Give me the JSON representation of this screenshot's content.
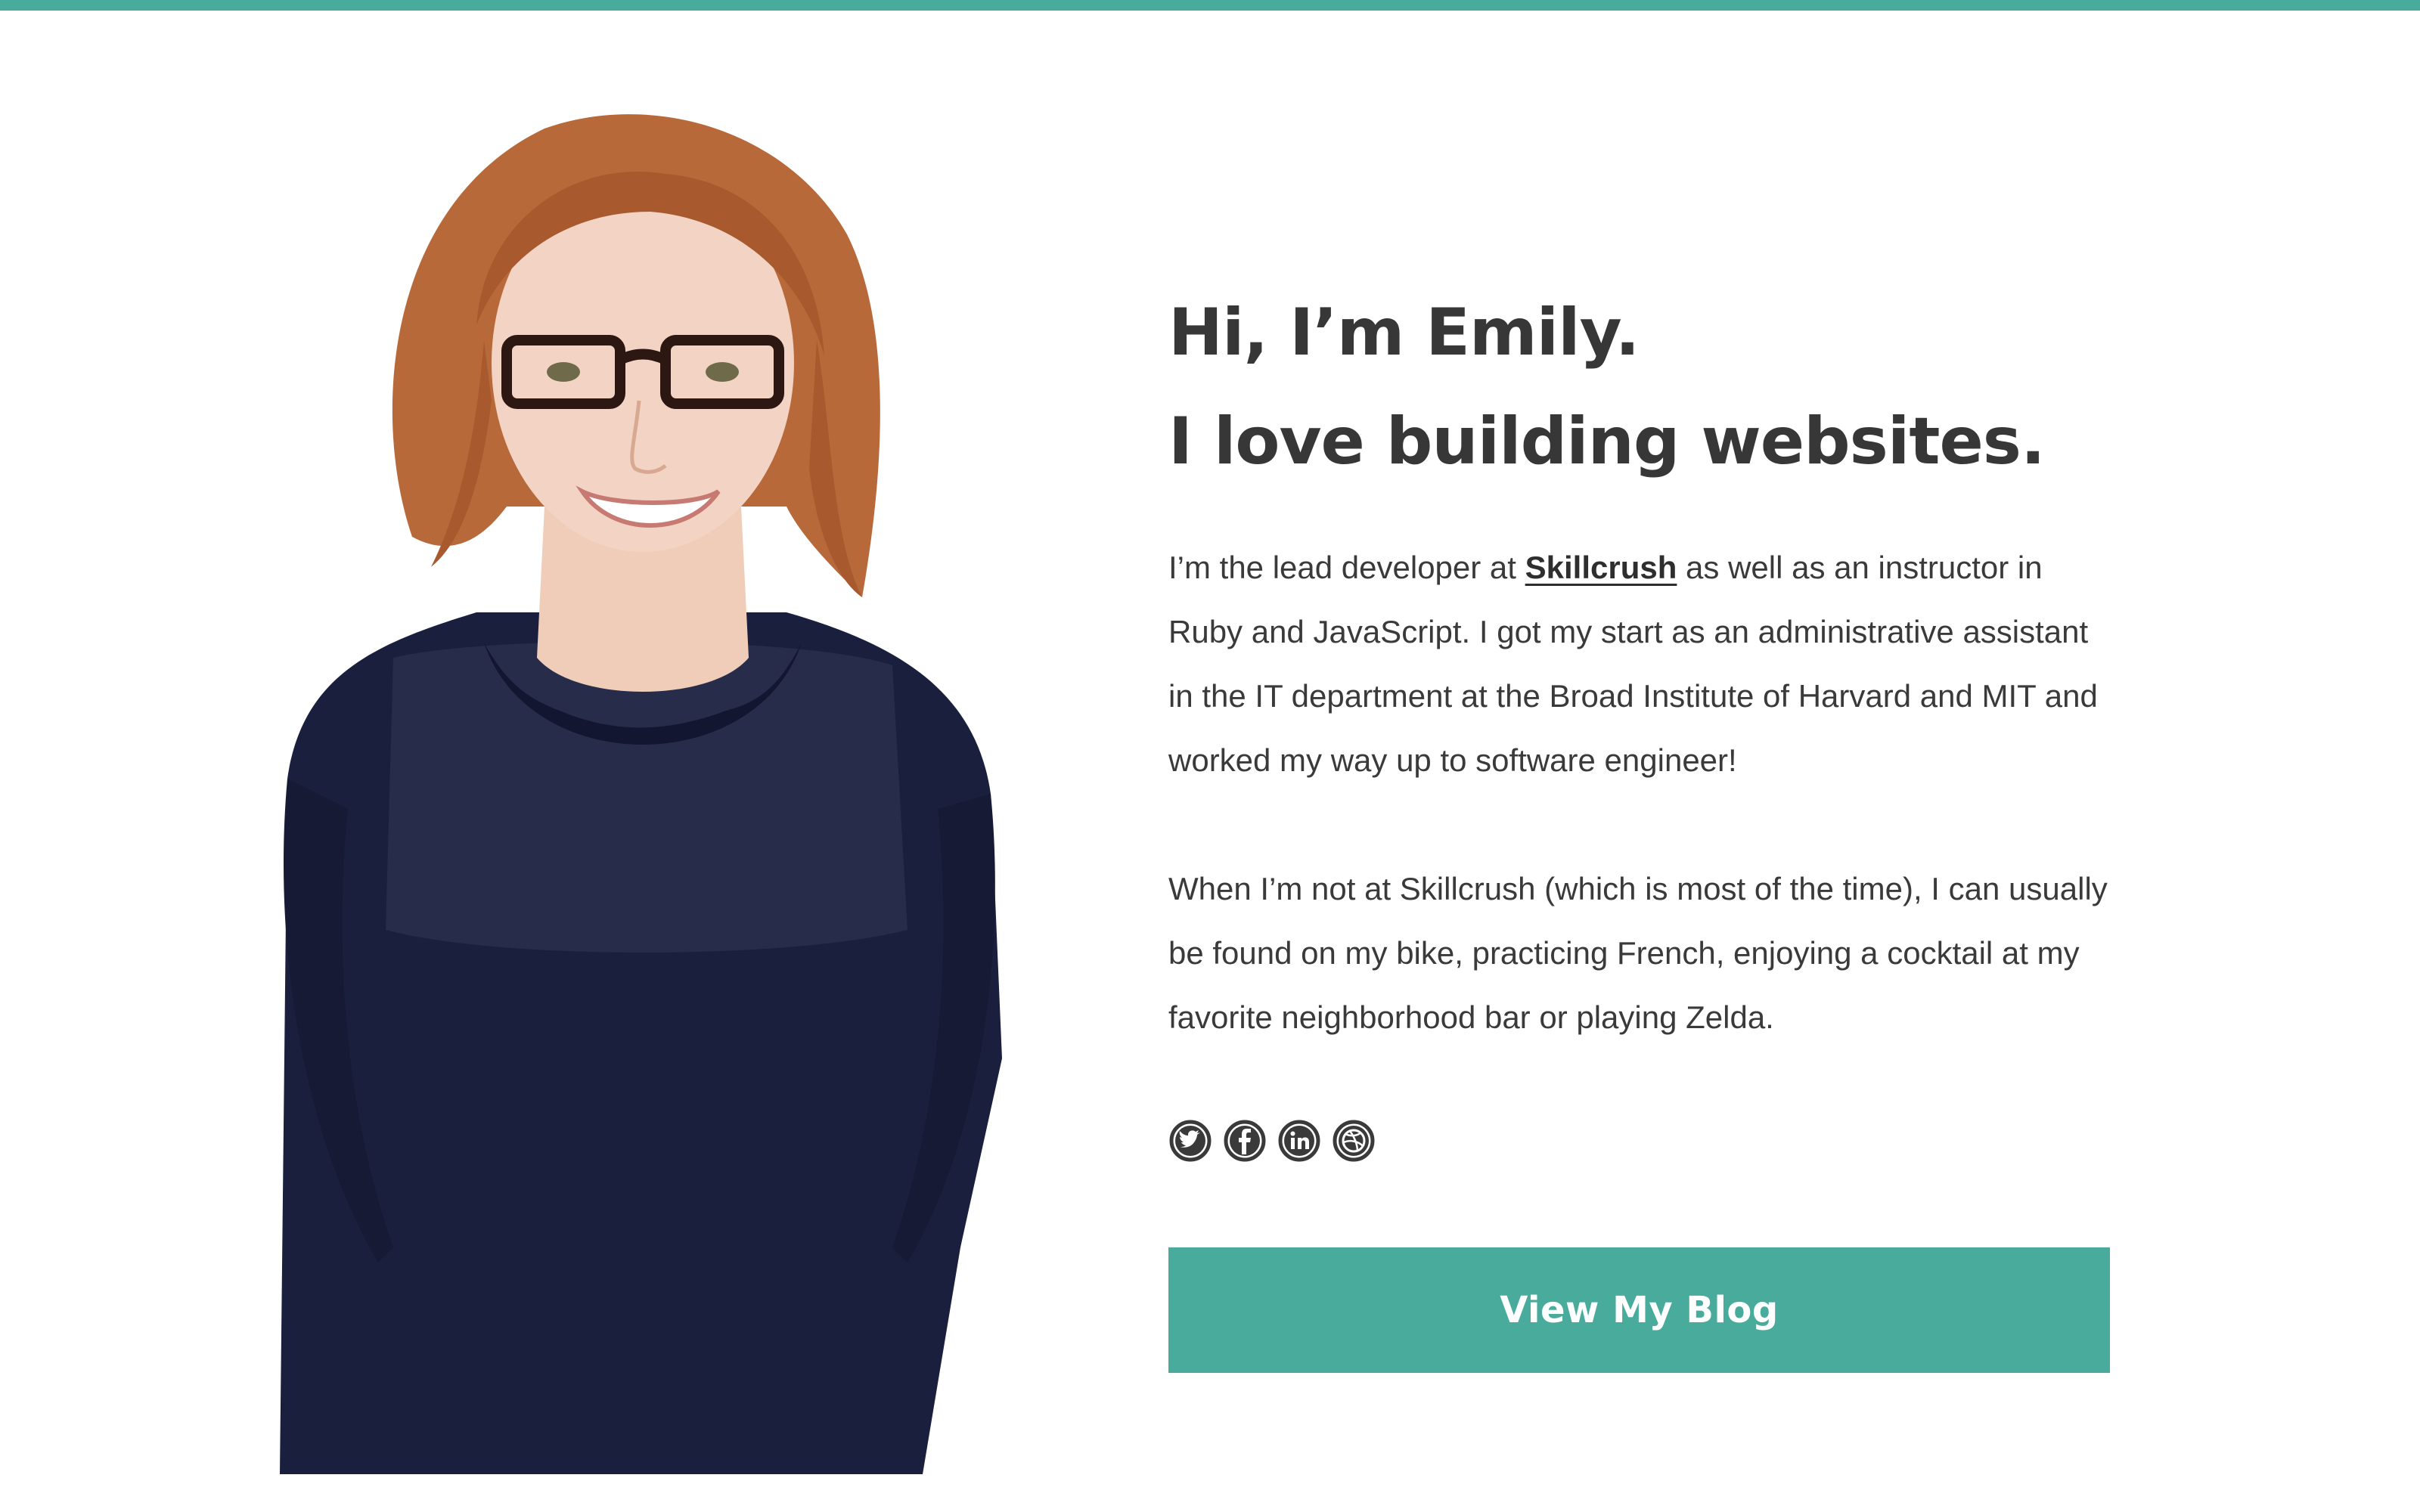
{
  "theme": {
    "accent": "#48ab9c",
    "text": "#3a3a3a",
    "heading": "#373737"
  },
  "hero": {
    "headline_line1": "Hi, I’m Emily.",
    "headline_line2": "I love building websites."
  },
  "bio": {
    "p1_before": "I’m the lead developer at ",
    "p1_link": "Skillcrush",
    "p1_after": " as well as an instructor in Ruby and JavaScript. I got my start as an administrative assistant in the IT department at the Broad Institute of Harvard and MIT and worked my way up to software engineer!",
    "p2": "When I’m not at Skillcrush (which is most of the time), I can usually be found on my bike, practicing French, enjoying a cocktail at my favorite neighborhood bar or playing Zelda."
  },
  "social": [
    {
      "icon": "twitter-icon"
    },
    {
      "icon": "facebook-icon"
    },
    {
      "icon": "linkedin-icon"
    },
    {
      "icon": "dribbble-icon"
    }
  ],
  "cta": {
    "label": "View My Blog"
  },
  "portrait": {
    "hair": "#b8693a",
    "sweater": "#1a1f3d",
    "skin": "#f3d4c4"
  }
}
